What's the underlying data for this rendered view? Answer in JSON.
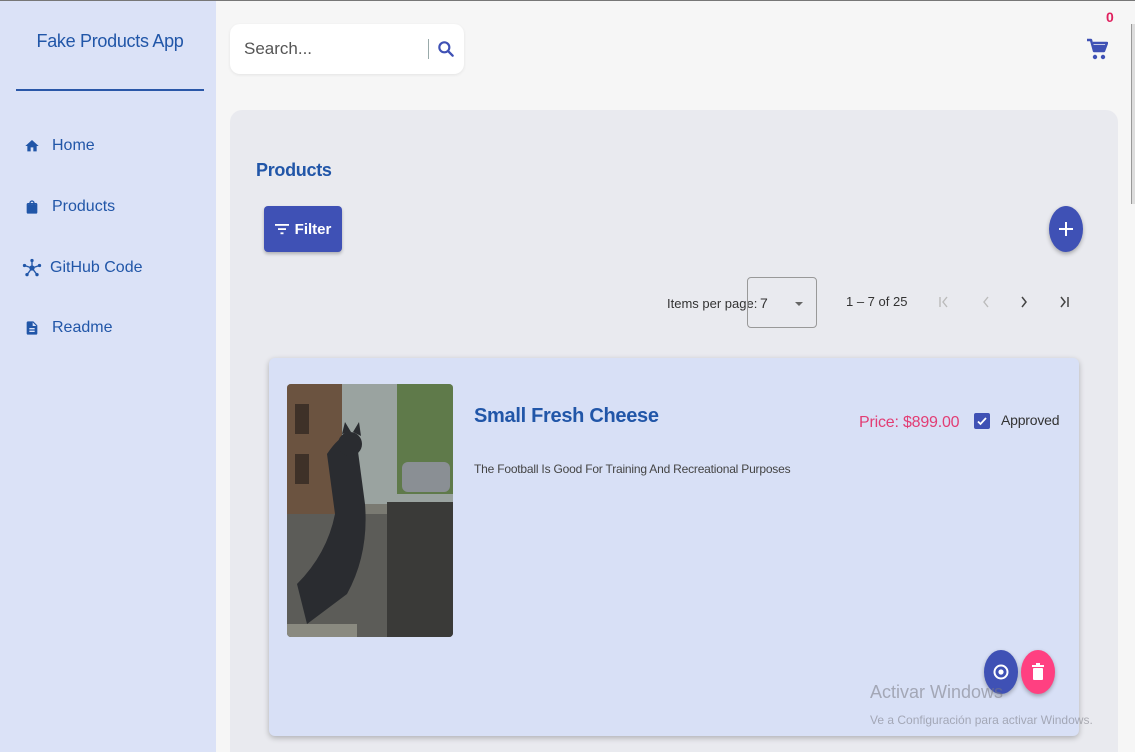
{
  "app": {
    "title": "Fake Products App"
  },
  "sidebar": {
    "items": [
      {
        "label": "Home",
        "icon": "home-icon"
      },
      {
        "label": "Products",
        "icon": "shopping-bag-icon"
      },
      {
        "label": "GitHub Code",
        "icon": "hub-icon"
      },
      {
        "label": "Readme",
        "icon": "document-icon"
      }
    ]
  },
  "search": {
    "placeholder": "Search..."
  },
  "cart": {
    "count": "0"
  },
  "products": {
    "title": "Products",
    "filter_label": "Filter"
  },
  "paginator": {
    "items_per_page_label": "Items per page:",
    "items_per_page_value": "7",
    "range_label": "1 – 7 of 25"
  },
  "product": {
    "name": "Small Fresh Cheese",
    "description": "The Football Is Good For Training And Recreational Purposes",
    "price": "Price: $899.00",
    "approved_label": "Approved",
    "approved": true
  },
  "watermark": {
    "title": "Activar Windows",
    "subtitle": "Ve a Configuración para activar Windows."
  },
  "colors": {
    "primary": "#3f51b5",
    "accent": "#ff4081",
    "brand_text": "#2156a8",
    "sidebar_bg": "#dbe2f7",
    "card_bg": "#d8e0f6"
  }
}
